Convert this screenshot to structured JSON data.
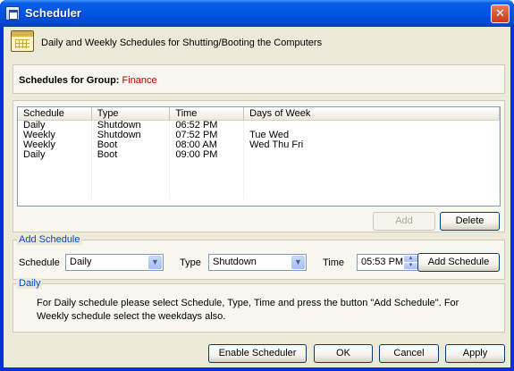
{
  "window": {
    "title": "Scheduler",
    "close_glyph": "✕"
  },
  "header": {
    "text": "Daily and Weekly Schedules for Shutting/Booting the Computers",
    "icon": "calendar-icon"
  },
  "group": {
    "label": "Schedules for Group:",
    "value": "Finance"
  },
  "table": {
    "columns": [
      "Schedule",
      "Type",
      "Time",
      "Days of Week"
    ],
    "rows": [
      [
        "Daily",
        "Shutdown",
        "06:52 PM",
        ""
      ],
      [
        "Weekly",
        "Shutdown",
        "07:52 PM",
        "Tue Wed"
      ],
      [
        "Weekly",
        "Boot",
        "08:00 AM",
        "Wed Thu Fri"
      ],
      [
        "Daily",
        "Boot",
        "09:00 PM",
        ""
      ]
    ]
  },
  "list_buttons": {
    "add": "Add",
    "delete": "Delete"
  },
  "add_schedule": {
    "legend": "Add Schedule",
    "schedule_label": "Schedule",
    "schedule_value": "Daily",
    "type_label": "Type",
    "type_value": "Shutdown",
    "time_label": "Time",
    "time_value": "05:53 PM",
    "add_button": "Add Schedule"
  },
  "info": {
    "legend": "Daily",
    "text": "For Daily schedule please select Schedule, Type, Time and press the button \"Add Schedule\". For Weekly schedule select the weekdays also."
  },
  "footer": {
    "enable": "Enable Scheduler",
    "ok": "OK",
    "cancel": "Cancel",
    "apply": "Apply"
  }
}
